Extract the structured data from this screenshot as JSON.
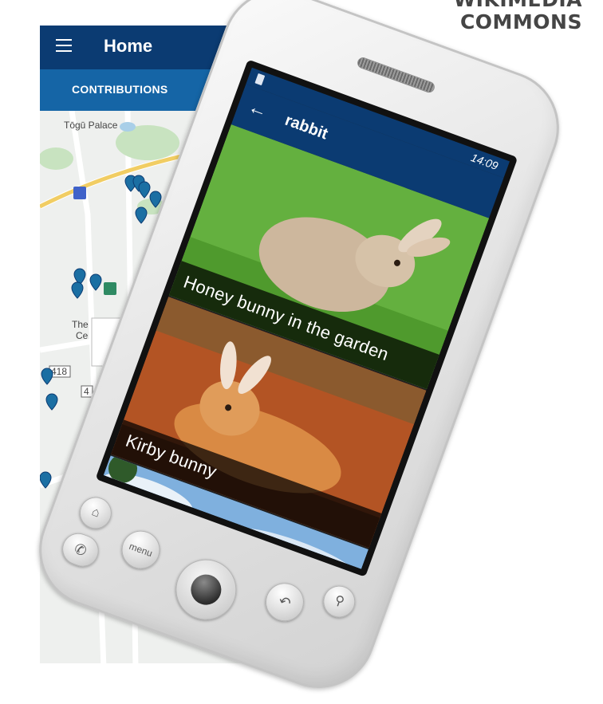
{
  "brand": {
    "line1": "WIKIMEDIA",
    "line2": "COMMONS"
  },
  "background_app": {
    "title": "Home",
    "tab": "CONTRIBUTIONS",
    "map_labels": [
      "Tōgū Palace",
      "The",
      "Ce",
      "418",
      "4"
    ]
  },
  "phone": {
    "status_time": "14:09",
    "screen_title": "rabbit",
    "photos": [
      {
        "caption": "Honey bunny in the garden"
      },
      {
        "caption": "Kirby bunny"
      },
      {
        "caption": ""
      }
    ],
    "buttons": {
      "menu": "menu"
    }
  },
  "colors": {
    "app_bar": "#0b3b72",
    "tab_bar": "#1565a6",
    "map_pin": "#1b6fa3"
  }
}
